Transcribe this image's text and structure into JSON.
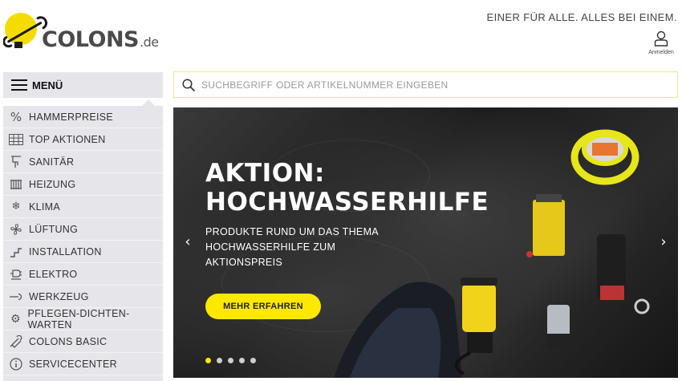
{
  "brand": {
    "logo_main": "COLONS",
    "logo_tld": ".de"
  },
  "header": {
    "slogan": "EINER FÜR ALLE. ALLES BEI EINEM.",
    "account_label": "Anmelden"
  },
  "menu": {
    "label": "MENÜ"
  },
  "search": {
    "placeholder": "SUCHBEGRIFF ODER ARTIKELNUMMER EINGEBEN"
  },
  "categories": [
    {
      "label": "HAMMERPREISE",
      "icon": "percent-icon"
    },
    {
      "label": "TOP AKTIONEN",
      "icon": "grid-icon"
    },
    {
      "label": "SANITÄR",
      "icon": "faucet-icon"
    },
    {
      "label": "HEIZUNG",
      "icon": "radiator-icon"
    },
    {
      "label": "KLIMA",
      "icon": "snowflake-icon"
    },
    {
      "label": "LÜFTUNG",
      "icon": "fan-icon"
    },
    {
      "label": "INSTALLATION",
      "icon": "pipe-icon"
    },
    {
      "label": "ELEKTRO",
      "icon": "plug-icon"
    },
    {
      "label": "WERKZEUG",
      "icon": "wrench-icon"
    },
    {
      "label": "PFLEGEN-DICHTEN-WARTEN",
      "icon": "gears-icon"
    },
    {
      "label": "COLONS BASIC",
      "icon": "tools-icon"
    },
    {
      "label": "SERVICECENTER",
      "icon": "info-icon"
    }
  ],
  "hero": {
    "title_line1": "AKTION:",
    "title_line2": "HOCHWASSERHILFE",
    "subtitle": "PRODUKTE RUND UM DAS THEMA HOCHWASSERHILFE ZUM AKTIONSPREIS",
    "cta_label": "MEHR ERFAHREN",
    "slide_count": 5,
    "active_slide": 1
  },
  "colors": {
    "accent": "#ffe800",
    "sidebar_bg": "#e6e6ea",
    "search_border": "#f1e38a"
  }
}
